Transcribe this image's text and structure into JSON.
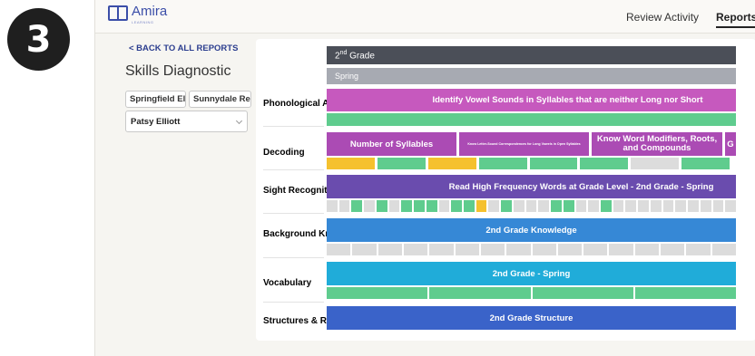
{
  "step": {
    "number": "3"
  },
  "header": {
    "logo_text": "Amira",
    "logo_sub": "LEARNING",
    "nav_review": "Review Activity",
    "nav_reports": "Reports"
  },
  "sidebar": {
    "back_link": "< BACK TO ALL REPORTS",
    "title": "Skills Diagnostic",
    "school_filter_1": "Springfield El...",
    "school_filter_2": "Sunnydale Re...",
    "student": "Patsy Elliott"
  },
  "report": {
    "grade_number": "2",
    "grade_suffix": "nd",
    "grade_word": "Grade",
    "season": "Spring",
    "skills": [
      {
        "label": "Phonological Awareness",
        "color": "#b545a8"
      },
      {
        "label": "Decoding",
        "color": "#b545a8"
      },
      {
        "label": "Sight Recognition",
        "color": "#5640a0"
      },
      {
        "label": "Background Knowledge",
        "color": "#2c7fcf"
      },
      {
        "label": "Vocabulary",
        "color": "#1e9ecf"
      },
      {
        "label": "Structures & Reasoning",
        "color": "#2e54b5"
      }
    ],
    "tiles": {
      "phonological": "Identify Vowel Sounds in Syllables that are neither Long nor Short",
      "decoding_1": "Number of Syllables",
      "decoding_2": "Know Letter-Sound Correspondences for Long Vowels in Open Syllables",
      "decoding_3": "Know Word Modifiers, Roots, and Compounds",
      "decoding_4": "G",
      "sight": "Read High Frequency Words at Grade Level - 2nd Grade - Spring",
      "background": "2nd Grade Knowledge",
      "vocabulary": "2nd Grade - Spring",
      "structures": "2nd Grade Structure"
    },
    "colors": {
      "mastered": "#5fcc8e",
      "partial": "#f5c12e",
      "untested": "#dcdcdc"
    },
    "cells": {
      "decoding": [
        "partial",
        "mastered",
        "partial",
        "mastered",
        "mastered",
        "mastered",
        "untested",
        "mastered"
      ],
      "sight": [
        "untested",
        "untested",
        "mastered",
        "untested",
        "mastered",
        "untested",
        "mastered",
        "mastered",
        "mastered",
        "untested",
        "mastered",
        "mastered",
        "partial",
        "untested",
        "mastered",
        "untested",
        "untested",
        "untested",
        "mastered",
        "mastered",
        "untested",
        "untested",
        "mastered",
        "untested",
        "untested",
        "untested",
        "untested",
        "untested",
        "untested",
        "untested",
        "untested",
        "untested",
        "untested"
      ],
      "background": [
        "untested",
        "untested",
        "untested",
        "untested",
        "untested",
        "untested",
        "untested",
        "untested",
        "untested",
        "untested",
        "untested",
        "untested",
        "untested",
        "untested",
        "untested",
        "untested"
      ],
      "vocabulary": [
        "mastered",
        "mastered",
        "mastered",
        "mastered"
      ]
    }
  }
}
